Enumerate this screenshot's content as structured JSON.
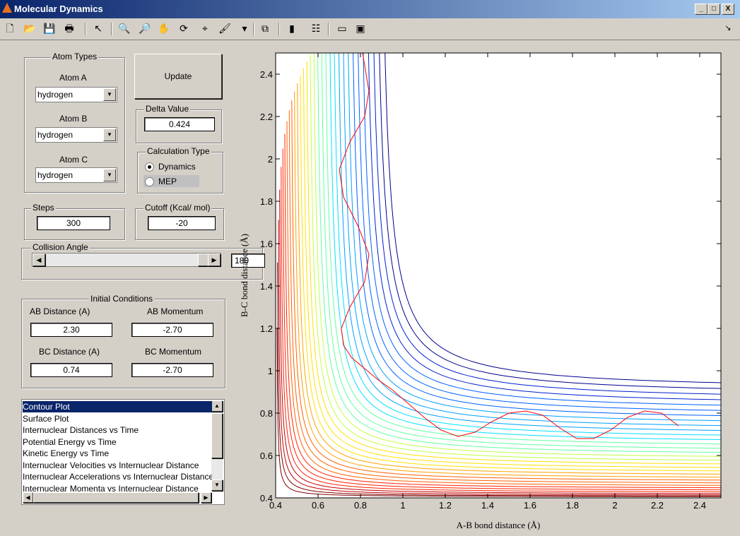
{
  "window": {
    "title": "Molecular Dynamics",
    "controls": [
      "_",
      "□",
      "X"
    ]
  },
  "toolbar": {
    "icons": [
      "new-file-icon",
      "open-folder-icon",
      "save-icon",
      "print-icon",
      "pointer-icon",
      "zoom-in-icon",
      "zoom-out-icon",
      "pan-hand-icon",
      "rotate-3d-icon",
      "data-cursor-icon",
      "brush-icon",
      "dropdown-arrow-icon",
      "link-plot-icon",
      "colorbar-icon",
      "legend-icon",
      "hide-plot-tools-icon",
      "show-plot-tools-icon"
    ],
    "glyphs": [
      "🗋",
      "📂",
      "💾",
      "🖶",
      "↖",
      "🔍",
      "🔎",
      "✋",
      "⟳",
      "⌖",
      "🖌",
      "▾",
      "⧉",
      "▮",
      "☷",
      "▭",
      "▣"
    ],
    "dock_arrow": "↘"
  },
  "atom_types": {
    "title": "Atom Types",
    "atom_a": {
      "label": "Atom A",
      "value": "hydrogen"
    },
    "atom_b": {
      "label": "Atom B",
      "value": "hydrogen"
    },
    "atom_c": {
      "label": "Atom C",
      "value": "hydrogen"
    }
  },
  "update_label": "Update",
  "delta": {
    "title": "Delta Value",
    "value": "0.424"
  },
  "calc_type": {
    "title": "Calculation Type",
    "options": [
      "Dynamics",
      "MEP"
    ],
    "selected": "Dynamics"
  },
  "steps": {
    "title": "Steps",
    "value": "300"
  },
  "cutoff": {
    "title": "Cutoff (Kcal/ mol)",
    "value": "-20"
  },
  "collision": {
    "title": "Collision Angle",
    "value": "180",
    "slider_fraction": 1.0
  },
  "initial": {
    "title": "Initial Conditions",
    "ab_distance": {
      "label": "AB Distance (A)",
      "value": "2.30"
    },
    "ab_momentum": {
      "label": "AB Momentum",
      "value": "-2.70"
    },
    "bc_distance": {
      "label": "BC Distance (A)",
      "value": "0.74"
    },
    "bc_momentum": {
      "label": "BC Momentum",
      "value": "-2.70"
    }
  },
  "plot_list": {
    "items": [
      "Contour Plot",
      "Surface Plot",
      "Internuclear Distances vs Time",
      "Potential Energy vs Time",
      "Kinetic Energy vs Time",
      "Internuclear Velocities vs Internuclear Distance",
      "Internuclear Accelerations vs Internuclear Distance",
      "Internuclear Momenta vs Internuclear Distance"
    ],
    "selected": 0
  },
  "chart_data": {
    "type": "contour",
    "xlabel": "A-B bond distance (Å)",
    "ylabel": "B-C bond distance (Å)",
    "xlim": [
      0.4,
      2.5
    ],
    "ylim": [
      0.4,
      2.5
    ],
    "xticks": [
      "0.4",
      "0.6",
      "0.8",
      "1",
      "1.2",
      "1.4",
      "1.6",
      "1.8",
      "2",
      "2.2",
      "2.4"
    ],
    "yticks": [
      "0.4",
      "0.6",
      "0.8",
      "1",
      "1.2",
      "1.4",
      "1.6",
      "1.8",
      "2",
      "2.2",
      "2.4"
    ],
    "colormap": [
      "#800000",
      "#c00000",
      "#ff2000",
      "#ff6000",
      "#ffa000",
      "#ffe000",
      "#c0ff40",
      "#60ffa0",
      "#00e0ff",
      "#00a0ff",
      "#0060ff",
      "#0020d0",
      "#00008f"
    ],
    "trajectory_color": "#ff0000",
    "trajectory": [
      [
        2.3,
        0.74
      ],
      [
        2.22,
        0.8
      ],
      [
        2.14,
        0.81
      ],
      [
        2.06,
        0.78
      ],
      [
        1.98,
        0.72
      ],
      [
        1.9,
        0.68
      ],
      [
        1.82,
        0.68
      ],
      [
        1.74,
        0.73
      ],
      [
        1.66,
        0.79
      ],
      [
        1.58,
        0.81
      ],
      [
        1.5,
        0.8
      ],
      [
        1.42,
        0.76
      ],
      [
        1.34,
        0.71
      ],
      [
        1.26,
        0.69
      ],
      [
        1.18,
        0.72
      ],
      [
        1.1,
        0.78
      ],
      [
        1.02,
        0.85
      ],
      [
        0.95,
        0.91
      ],
      [
        0.88,
        0.96
      ],
      [
        0.82,
        1.01
      ],
      [
        0.76,
        1.06
      ],
      [
        0.72,
        1.12
      ],
      [
        0.71,
        1.2
      ],
      [
        0.75,
        1.3
      ],
      [
        0.82,
        1.42
      ],
      [
        0.84,
        1.55
      ],
      [
        0.79,
        1.68
      ],
      [
        0.72,
        1.82
      ],
      [
        0.7,
        1.95
      ],
      [
        0.75,
        2.08
      ],
      [
        0.82,
        2.2
      ],
      [
        0.84,
        2.32
      ],
      [
        0.82,
        2.44
      ],
      [
        0.81,
        2.5
      ]
    ]
  }
}
